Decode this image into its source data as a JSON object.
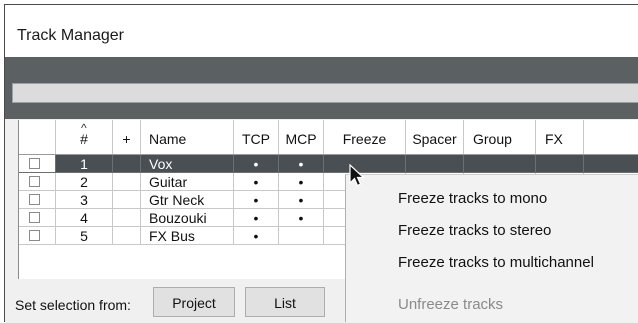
{
  "window": {
    "title": "Track Manager"
  },
  "columns": [
    {
      "key": "select",
      "label": ""
    },
    {
      "key": "num",
      "label": "#"
    },
    {
      "key": "plus",
      "label": "+"
    },
    {
      "key": "name",
      "label": "Name"
    },
    {
      "key": "tcp",
      "label": "TCP"
    },
    {
      "key": "mcp",
      "label": "MCP"
    },
    {
      "key": "freeze",
      "label": "Freeze"
    },
    {
      "key": "spacer",
      "label": "Spacer"
    },
    {
      "key": "group",
      "label": "Group"
    },
    {
      "key": "fx",
      "label": "FX"
    }
  ],
  "sort_indicator": "^",
  "tracks": [
    {
      "num": "1",
      "name": "Vox",
      "tcp": "•",
      "mcp": "•",
      "selected": true
    },
    {
      "num": "2",
      "name": "Guitar",
      "tcp": "•",
      "mcp": "•",
      "selected": false
    },
    {
      "num": "3",
      "name": "Gtr Neck",
      "tcp": "•",
      "mcp": "•",
      "selected": false
    },
    {
      "num": "4",
      "name": "Bouzouki",
      "tcp": "•",
      "mcp": "•",
      "selected": false
    },
    {
      "num": "5",
      "name": "FX Bus",
      "tcp": "•",
      "mcp": "",
      "selected": false
    }
  ],
  "bottom": {
    "set_selection_label": "Set selection from:",
    "project_button": "Project",
    "list_button": "List"
  },
  "context_menu": {
    "items": [
      {
        "label": "Freeze tracks to mono",
        "enabled": true
      },
      {
        "label": "Freeze tracks to stereo",
        "enabled": true
      },
      {
        "label": "Freeze tracks to multichannel",
        "enabled": true
      },
      {
        "label": "Unfreeze tracks",
        "enabled": false
      }
    ]
  },
  "colors": {
    "selected_row": "#4a4f54",
    "toolbar_dark": "#5b6063"
  }
}
